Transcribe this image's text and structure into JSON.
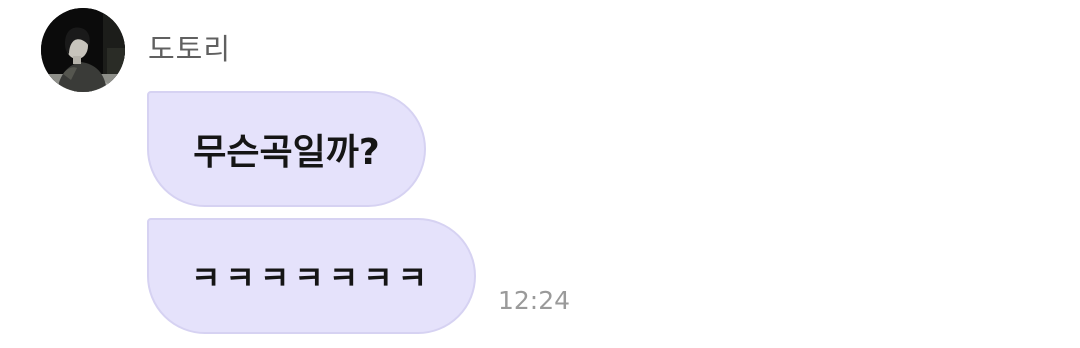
{
  "sender": {
    "name": "도토리"
  },
  "messages": [
    {
      "text": "무슨곡일까?"
    },
    {
      "text": "ㅋㅋㅋㅋㅋㅋㅋ"
    }
  ],
  "timestamp": "12:24",
  "colors": {
    "bubble": "#e5e2fb",
    "bubble_border": "#d6d2f2",
    "name_text": "#606060",
    "time_text": "#9a9a9a"
  },
  "icons": {
    "avatar": "profile-photo-icon"
  }
}
